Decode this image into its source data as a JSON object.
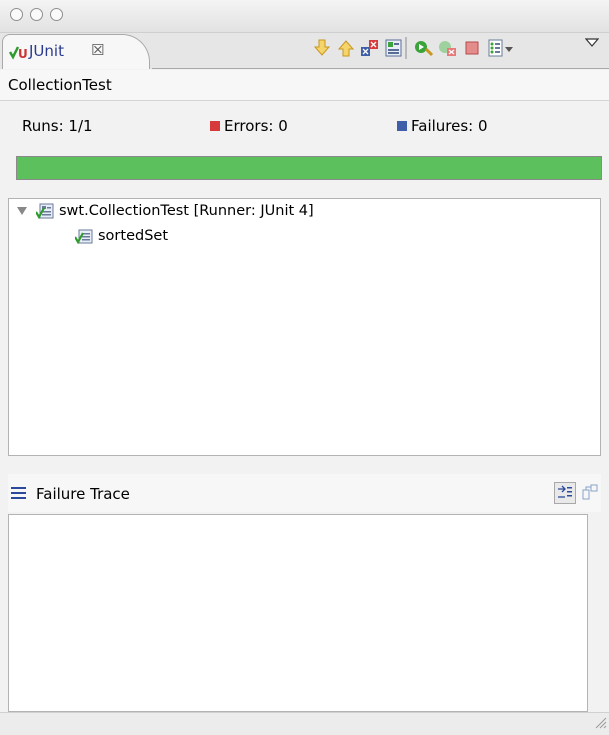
{
  "tab": {
    "label": "JUnit",
    "close": "☒",
    "icon": "junit-icon"
  },
  "header": {
    "title": "CollectionTest"
  },
  "counters": {
    "runs": "Runs:  1/1",
    "errors": "Errors:  0",
    "failures": "Failures:  0"
  },
  "progress": {
    "fraction": 1.0,
    "color": "#5cc15c"
  },
  "tree": {
    "suite": "swt.CollectionTest [Runner: JUnit 4]",
    "test": "sortedSet"
  },
  "trace": {
    "title": "Failure Trace"
  },
  "colors": {
    "error": "#d73a3a",
    "failure": "#3f5fa8",
    "tab_text": "#2a3b8f"
  }
}
